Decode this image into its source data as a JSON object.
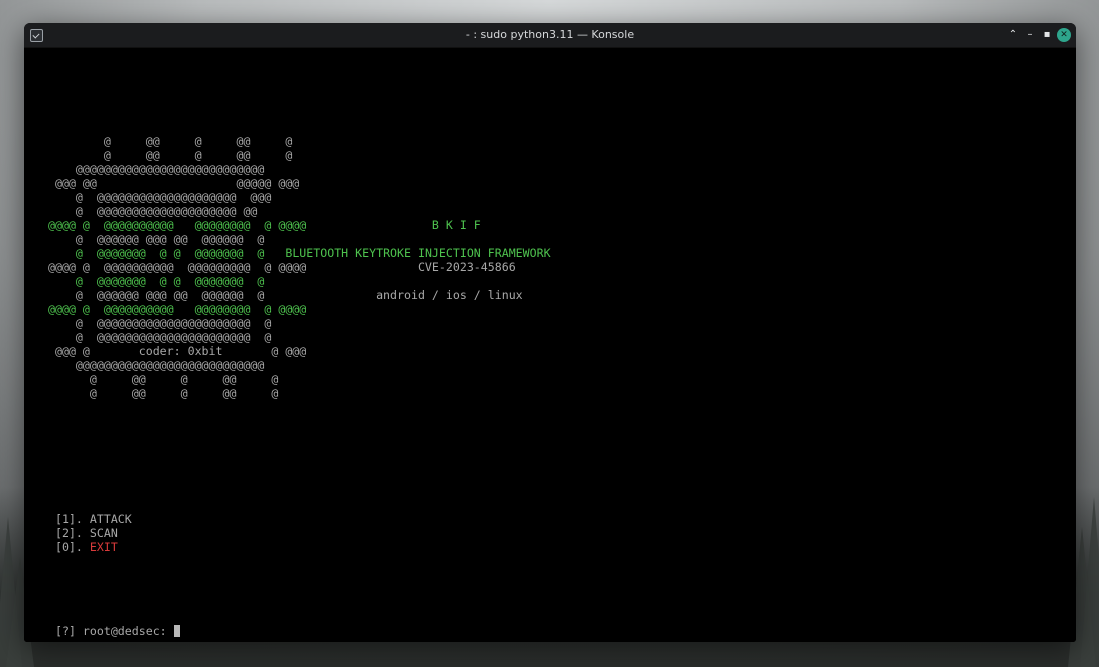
{
  "window": {
    "title": "- : sudo python3.11 — Konsole",
    "controls": {
      "keep_above": "⌃",
      "minimize": "–",
      "maximize": "▪",
      "close": "✕"
    }
  },
  "banner": {
    "rows": [
      [
        [
          "w",
          "        @     @@     @     @@     @"
        ]
      ],
      [
        [
          "w",
          "        @     @@     @     @@     @"
        ]
      ],
      [
        [
          "w",
          "    @@@@@@@@@@@@@@@@@@@@@@@@@@@"
        ]
      ],
      [
        [
          "w",
          " @@@ @@                    @@@@@ @@@"
        ]
      ],
      [
        [
          "w",
          "    @  @@@@@@@@@@@@@@@@@@@@  @@@"
        ]
      ],
      [
        [
          "w",
          "    @  @@@@@@@@@@@@@@@@@@@@ @@"
        ]
      ],
      [
        [
          "g",
          "@@@@ @  @@@@@@@@@@   @@@@@@@@  @ @@@@"
        ],
        [
          "w",
          "                  "
        ],
        [
          "g",
          "B K I F"
        ]
      ],
      [
        [
          "w",
          "    @  @@@@@@ @@@ @@  @@@@@@  @"
        ]
      ],
      [
        [
          "g",
          "    @  @@@@@@@  @ @  @@@@@@@  @"
        ],
        [
          "w",
          "   "
        ],
        [
          "g",
          "BLUETOOTH KEYTROKE INJECTION FRAMEWORK"
        ]
      ],
      [
        [
          "w",
          "@@@@ @  @@@@@@@@@@  @@@@@@@@@  @ @@@@"
        ],
        [
          "w",
          "                "
        ],
        [
          "w",
          "CVE-2023-45866"
        ]
      ],
      [
        [
          "g",
          "    @  @@@@@@@  @ @  @@@@@@@  @"
        ]
      ],
      [
        [
          "w",
          "    @  @@@@@@ @@@ @@  @@@@@@  @"
        ],
        [
          "w",
          "                "
        ],
        [
          "w",
          "android / ios / linux"
        ]
      ],
      [
        [
          "g",
          "@@@@ @  @@@@@@@@@@   @@@@@@@@  @ @@@@"
        ]
      ],
      [
        [
          "w",
          "    @  @@@@@@@@@@@@@@@@@@@@@@  @"
        ]
      ],
      [
        [
          "w",
          "    @  @@@@@@@@@@@@@@@@@@@@@@  @"
        ]
      ],
      [
        [
          "w",
          " @@@ @       coder: 0xbit       @ @@@"
        ]
      ],
      [
        [
          "w",
          "    @@@@@@@@@@@@@@@@@@@@@@@@@@@"
        ]
      ],
      [
        [
          "w",
          "      @     @@     @     @@     @"
        ]
      ],
      [
        [
          "w",
          "      @     @@     @     @@     @"
        ]
      ]
    ]
  },
  "menu": [
    {
      "prefix": " [1]. ",
      "label": "ATTACK",
      "tone": "w"
    },
    {
      "prefix": " [2]. ",
      "label": "SCAN",
      "tone": "w"
    },
    {
      "prefix": " [0]. ",
      "label": "EXIT",
      "tone": "r"
    }
  ],
  "prompt": {
    "text": " [?] root@dedsec: "
  }
}
